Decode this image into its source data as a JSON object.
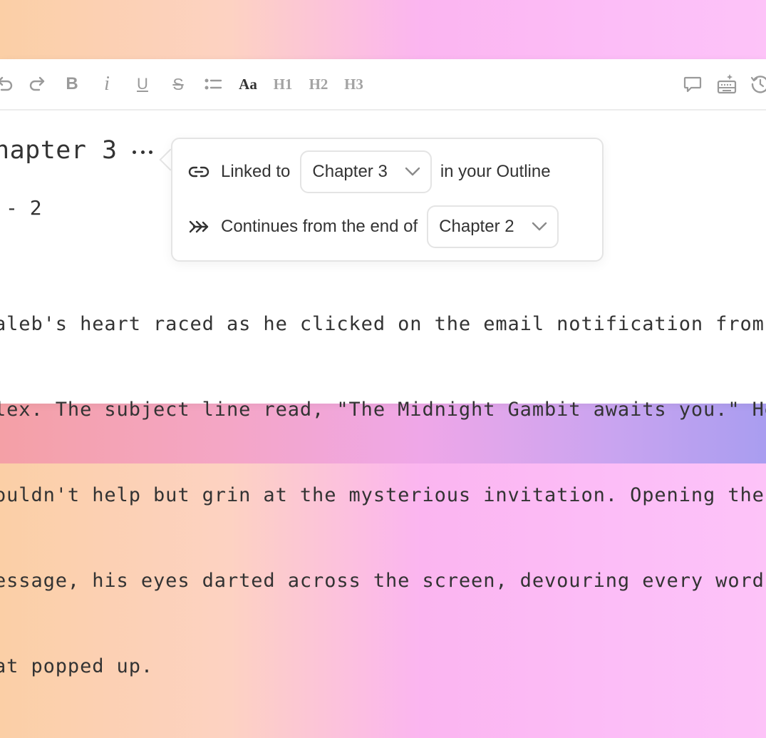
{
  "toolbar": {
    "items": [
      {
        "name": "undo-icon"
      },
      {
        "name": "redo-icon"
      },
      {
        "name": "bold-icon",
        "label": "B"
      },
      {
        "name": "italic-icon",
        "label": "i"
      },
      {
        "name": "underline-icon",
        "label": "U"
      },
      {
        "name": "strikethrough-icon",
        "label": "S"
      },
      {
        "name": "bullet-list-icon"
      },
      {
        "name": "font-style-button",
        "label": "Aa"
      },
      {
        "name": "heading-1-button",
        "label": "H1"
      },
      {
        "name": "heading-2-button",
        "label": "H2"
      },
      {
        "name": "heading-3-button",
        "label": "H3"
      },
      {
        "name": "comment-icon"
      },
      {
        "name": "ai-typewriter-icon"
      },
      {
        "name": "history-icon"
      }
    ],
    "font_style_label": "Aa",
    "h1_label": "H1",
    "h2_label": "H2",
    "h3_label": "H3",
    "bold_label": "B",
    "italic_label": "i",
    "underline_label": "U",
    "strike_label": "S"
  },
  "document": {
    "heading": "hapter 3",
    "subheading": "- 2",
    "body_lines": [
      "aleb's heart raced as he clicked on the email notification from",
      "lex. The subject line read, \"The Midnight Gambit awaits you.\" He",
      "ouldn't help but grin at the mysterious invitation. Opening the",
      "essage, his eyes darted across the screen, devouring every word",
      "at popped up."
    ]
  },
  "popover": {
    "linked_prefix": "Linked to",
    "linked_chapter": "Chapter 3",
    "linked_suffix": "in your Outline",
    "continues_prefix": "Continues from the end of",
    "continues_chapter": "Chapter 2"
  },
  "colors": {
    "icon_gray": "#9a9a9a",
    "text_dark": "#333333",
    "border": "#e4e4e4"
  }
}
